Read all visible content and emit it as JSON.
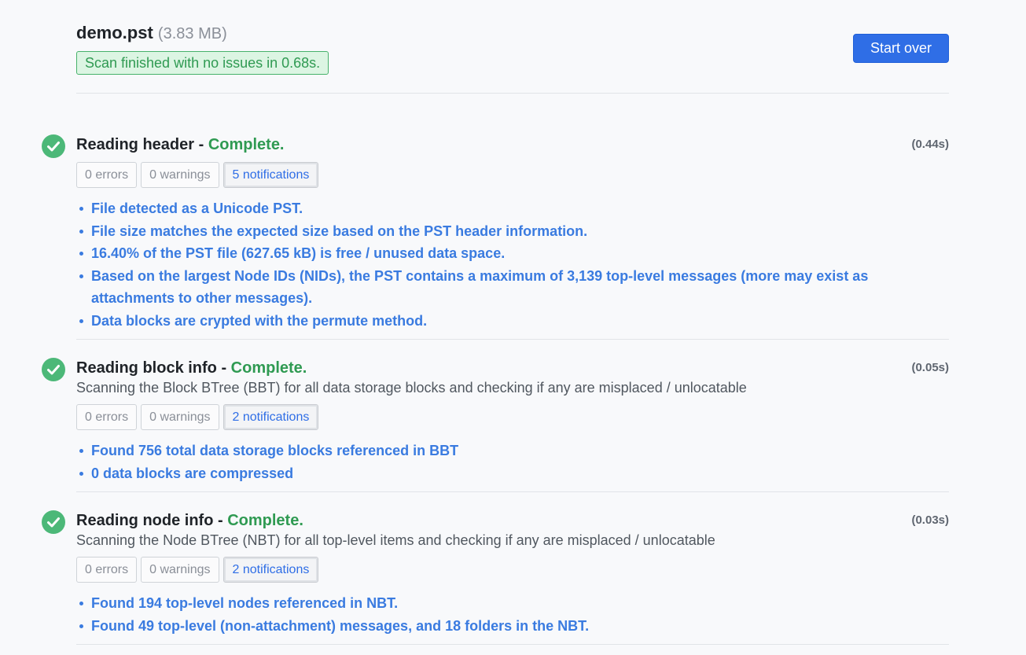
{
  "file": {
    "name": "demo.pst",
    "size": "(3.83 MB)",
    "status": "Scan finished with no issues in 0.68s."
  },
  "actions": {
    "start_over": "Start over"
  },
  "sections": [
    {
      "title": "Reading header - ",
      "status": "Complete.",
      "time": "(0.44s)",
      "description": "",
      "chips": {
        "errors": "0 errors",
        "warnings": "0 warnings",
        "notifications": "5 notifications"
      },
      "items": [
        "File detected as a Unicode PST.",
        "File size matches the expected size based on the PST header information.",
        "16.40% of the PST file (627.65 kB) is free / unused data space.",
        "Based on the largest Node IDs (NIDs), the PST contains a maximum of 3,139 top-level messages (more may exist as attachments to other messages).",
        "Data blocks are crypted with the permute method."
      ]
    },
    {
      "title": "Reading block info - ",
      "status": "Complete.",
      "time": "(0.05s)",
      "description": "Scanning the Block BTree (BBT) for all data storage blocks and checking if any are misplaced / unlocatable",
      "chips": {
        "errors": "0 errors",
        "warnings": "0 warnings",
        "notifications": "2 notifications"
      },
      "items": [
        "Found 756 total data storage blocks referenced in BBT",
        "0 data blocks are compressed"
      ]
    },
    {
      "title": "Reading node info - ",
      "status": "Complete.",
      "time": "(0.03s)",
      "description": "Scanning the Node BTree (NBT) for all top-level items and checking if any are misplaced / unlocatable",
      "chips": {
        "errors": "0 errors",
        "warnings": "0 warnings",
        "notifications": "2 notifications"
      },
      "items": [
        "Found 194 top-level nodes referenced in NBT.",
        "Found 49 top-level (non-attachment) messages, and 18 folders in the NBT."
      ]
    }
  ],
  "colors": {
    "success": "#2f9a52",
    "link": "#3a7be0",
    "primary_button": "#2f6ee6",
    "check_icon": "#4cb878"
  },
  "icons": {
    "section_status": "check-circle-icon"
  }
}
